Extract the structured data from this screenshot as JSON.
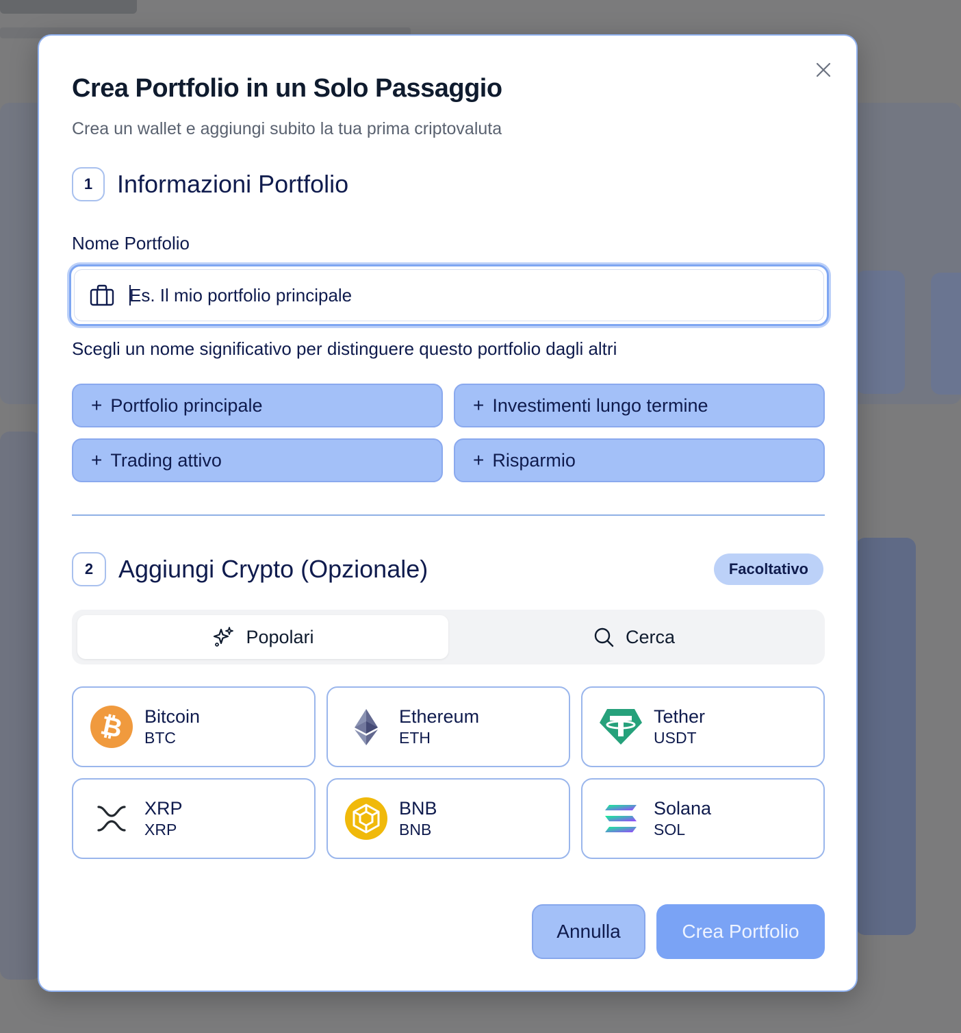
{
  "modal": {
    "title": "Crea Portfolio in un Solo Passaggio",
    "subtitle": "Crea un wallet e aggiungi subito la tua prima criptovaluta"
  },
  "step1": {
    "number": "1",
    "title": "Informazioni Portfolio",
    "field_label": "Nome Portfolio",
    "input_placeholder": "Es. Il mio portfolio principale",
    "input_value": "",
    "hint": "Scegli un nome significativo per distinguere questo portfolio dagli altri",
    "suggestions": [
      {
        "label": "Portfolio principale"
      },
      {
        "label": "Investimenti lungo termine"
      },
      {
        "label": "Trading attivo"
      },
      {
        "label": "Risparmio"
      }
    ]
  },
  "step2": {
    "number": "2",
    "title": "Aggiungi Crypto (Opzionale)",
    "badge": "Facoltativo",
    "tabs": [
      {
        "label": "Popolari",
        "icon": "sparkles-icon",
        "active": true
      },
      {
        "label": "Cerca",
        "icon": "search-icon",
        "active": false
      }
    ],
    "cryptos": [
      {
        "name": "Bitcoin",
        "symbol": "BTC",
        "icon": "bitcoin-icon",
        "color": "#f09a3e"
      },
      {
        "name": "Ethereum",
        "symbol": "ETH",
        "icon": "ethereum-icon",
        "color": "#62688f"
      },
      {
        "name": "Tether",
        "symbol": "USDT",
        "icon": "tether-icon",
        "color": "#26a17b"
      },
      {
        "name": "XRP",
        "symbol": "XRP",
        "icon": "xrp-icon",
        "color": "#23292f"
      },
      {
        "name": "BNB",
        "symbol": "BNB",
        "icon": "bnb-icon",
        "color": "#f0b90b"
      },
      {
        "name": "Solana",
        "symbol": "SOL",
        "icon": "solana-icon",
        "color": "#9945ff"
      }
    ]
  },
  "actions": {
    "cancel_label": "Annulla",
    "create_label": "Crea Portfolio"
  },
  "colors": {
    "accent": "#7aa3f5",
    "chip_bg": "#a3c0f8",
    "text_primary": "#0f1b4d"
  }
}
